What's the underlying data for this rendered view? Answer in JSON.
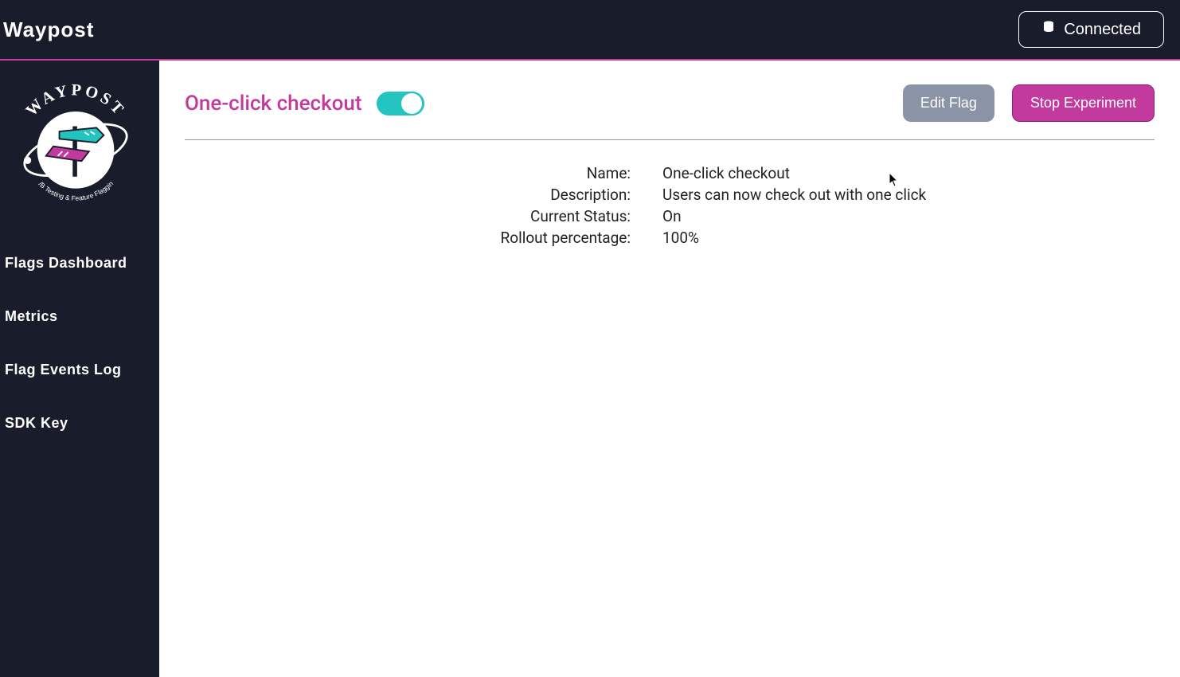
{
  "topbar": {
    "brand": "Waypost",
    "connected_label": "Connected"
  },
  "sidebar": {
    "items": [
      {
        "label": "Flags Dashboard"
      },
      {
        "label": "Metrics"
      },
      {
        "label": "Flag Events Log"
      },
      {
        "label": "SDK Key"
      }
    ]
  },
  "logo": {
    "brand_text": "WAYPOST",
    "tagline": "A/B Testing & Feature Flagging"
  },
  "header": {
    "title": "One-click checkout",
    "toggle_on": true,
    "edit_label": "Edit Flag",
    "stop_label": "Stop Experiment"
  },
  "details": {
    "rows": [
      {
        "label": "Name:",
        "value": "One-click checkout"
      },
      {
        "label": "Description:",
        "value": "Users can now check out with one click"
      },
      {
        "label": "Current Status:",
        "value": "On"
      },
      {
        "label": "Rollout percentage:",
        "value": "100%"
      }
    ]
  },
  "colors": {
    "accent_pink": "#c23a9e",
    "accent_teal": "#23c4c0",
    "dark_bg": "#191c2a",
    "muted_gray": "#8a94a6"
  }
}
